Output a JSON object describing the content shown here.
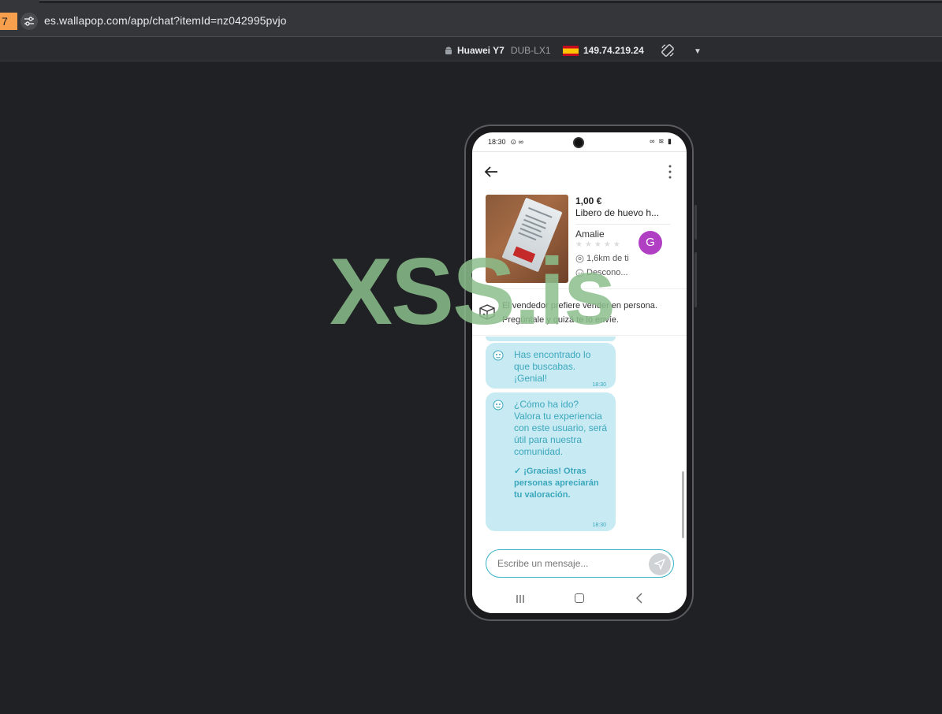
{
  "browser": {
    "tab_stub_text": "7",
    "url": "es.wallapop.com/app/chat?itemId=nz042995pvjo"
  },
  "device_bar": {
    "device_name": "Huawei Y7",
    "device_model": "DUB-LX1",
    "ip": "149.74.219.24"
  },
  "phone": {
    "status_time": "18:30",
    "item": {
      "price": "1,00 €",
      "title": "Libero de huevo h...",
      "seller": "Amalie",
      "stars": "★★★★★",
      "avatar_initial": "G",
      "distance": "1,6km de ti",
      "response": "Descono..."
    },
    "shipping_text": "El vendedor prefiere vender en persona. Pregúntale y quizá te lo envíe.",
    "messages": [
      {
        "text": "Has encontrado lo que buscabas. ¡Genial!",
        "time": "18:30"
      },
      {
        "text": "¿Cómo ha ido? Valora tu experiencia con este usuario, será útil para nuestra comunidad.",
        "thanks": "✓ ¡Gracias! Otras personas apreciarán tu valoración.",
        "time": "18:30"
      }
    ],
    "input_placeholder": "Escribe un mensaje..."
  },
  "colors": {
    "bubble_bg": "#c8eaf3",
    "bubble_text": "#3aa7bc",
    "avatar": "#b03fc3",
    "input_border": "#38b2c4"
  },
  "watermark": "XSS.is"
}
